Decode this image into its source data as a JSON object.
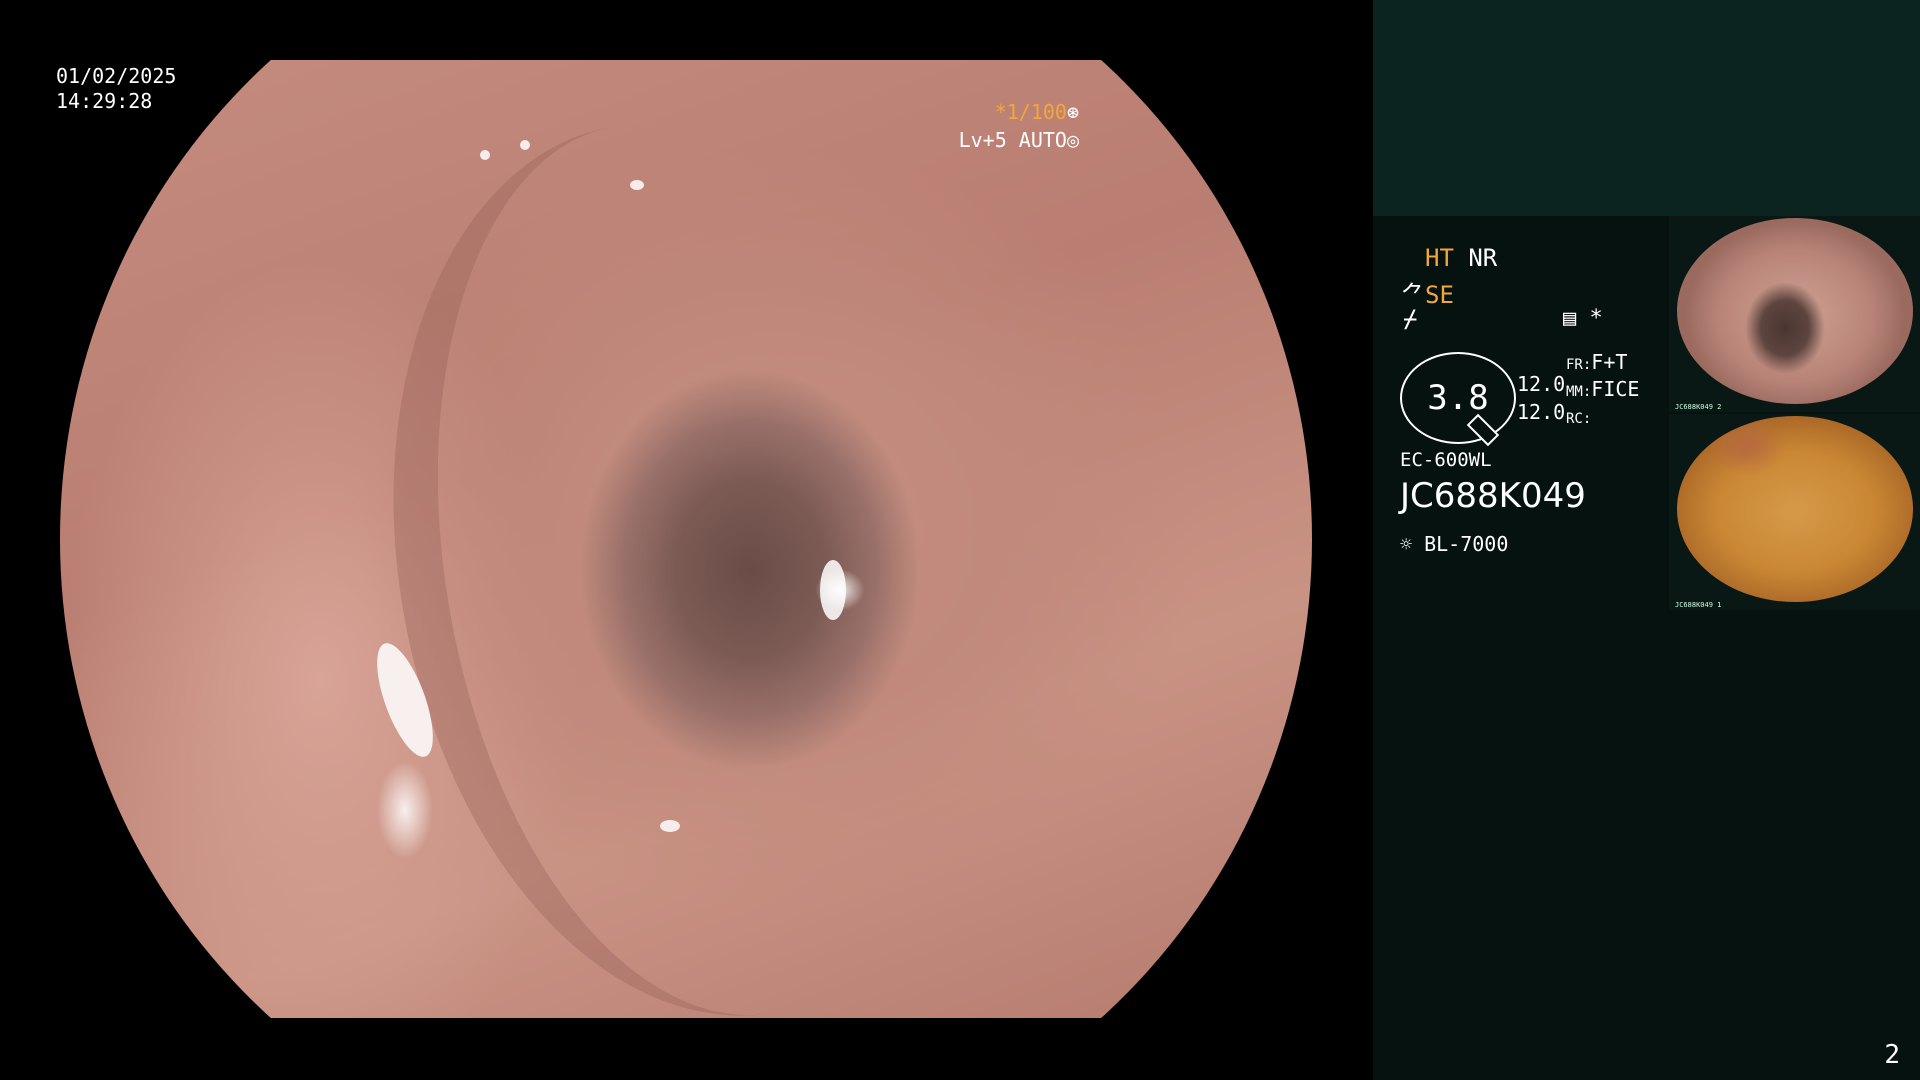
{
  "overlay": {
    "date": "01/02/2025",
    "time": "14:29:28",
    "shutter_speed": "*1/100",
    "shutter_icon": "aperture-icon",
    "level": "Lv+5 AUTO",
    "level_icon": "iris-icon"
  },
  "panel": {
    "ht": "HT",
    "nr": "NR",
    "se": "SE",
    "se_icon": "tool-icon",
    "lightning_icon": "lightning-icon",
    "lightning_symbol": "⌿",
    "memo_icon": "memo-icon",
    "memo_symbol": "▤",
    "star_symbol": "*",
    "zoom_value": "3.8",
    "zoom_left": "12.0",
    "zoom_right": "12.0",
    "fr_key": "FR:",
    "fr_value": "F+T",
    "mm_key": "MM:",
    "mm_value": "FICE",
    "rc_key": "RC:",
    "rc_value": "",
    "scope_model": "EC-600WL",
    "serial_number": "JC688K049",
    "light_source_icon": "light-source-icon",
    "light_source": "BL-7000"
  },
  "thumbnails": [
    {
      "caption_serial": "JC688K049",
      "caption_num": "2"
    },
    {
      "caption_serial": "JC688K049",
      "caption_num": "1"
    }
  ],
  "page_number": "2",
  "colors": {
    "accent_orange": "#f3a63a",
    "panel_bg": "#05120f",
    "panel_top_bg": "#0c2420"
  }
}
